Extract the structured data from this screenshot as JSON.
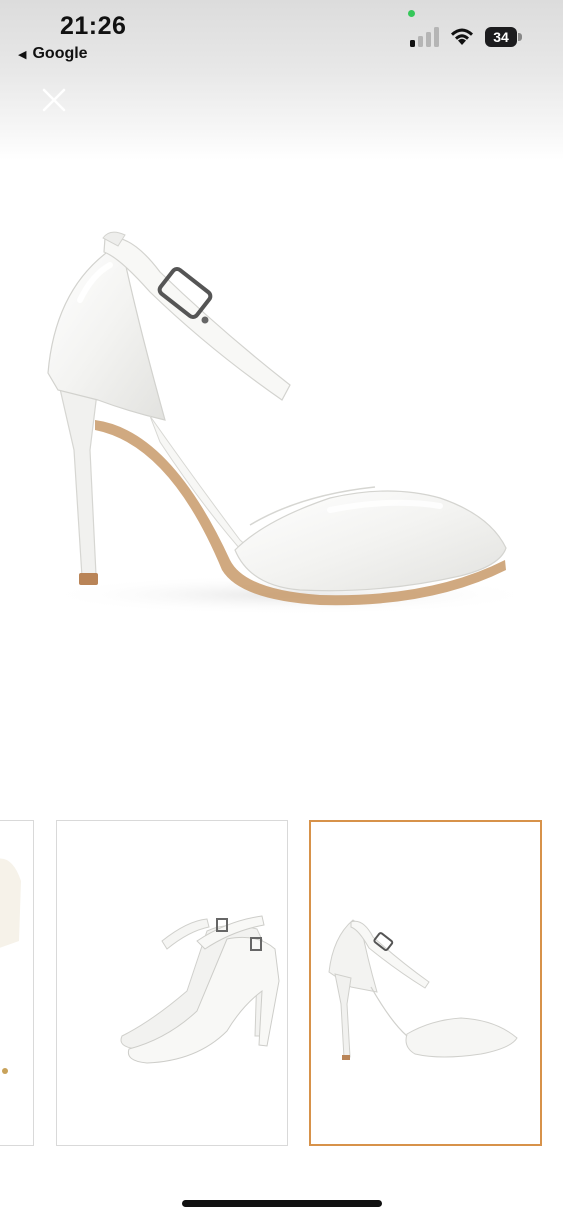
{
  "status_bar": {
    "time": "21:26",
    "back_app_label": "Google",
    "battery_level": "34",
    "icons": [
      "cellular-signal-icon",
      "wifi-icon",
      "battery-icon"
    ]
  },
  "viewer": {
    "close_icon": "close-icon",
    "thumbnails": [
      {
        "name": "thumbnail-1",
        "selected": false
      },
      {
        "name": "thumbnail-2",
        "selected": false
      },
      {
        "name": "thumbnail-3",
        "selected": true
      }
    ]
  },
  "colors": {
    "selected_border": "#d7924a",
    "thumb_border": "#d9d9d9",
    "recording_dot": "#35c759"
  }
}
